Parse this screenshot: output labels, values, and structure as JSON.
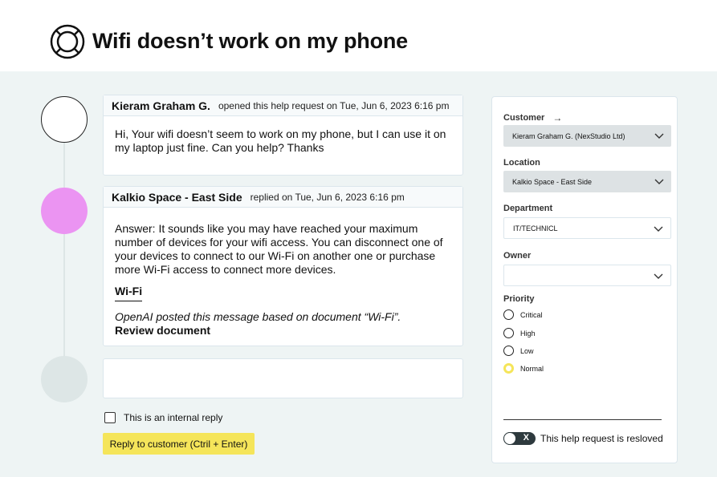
{
  "header": {
    "title": "Wifi doesn’t work on my phone",
    "icon": "lifebuoy-icon"
  },
  "thread": [
    {
      "author": "Kieram Graham G.",
      "meta": "opened this help request on Tue, Jun 6, 2023 6:16 pm",
      "body": "Hi, Your wifi doesn’t seem to work on my phone, but I can use it on my laptop just fine. Can you help? Thanks",
      "avatar_color": "#ffffff"
    },
    {
      "author": "Kalkio Space - East Side",
      "meta": "replied on Tue, Jun 6, 2023 6:16 pm",
      "body": "Answer: It sounds like you may have reached your maximum number of devices for your wifi access. You can disconnect one of your devices to connect to our Wi-Fi on another one or purchase more Wi-Fi access to connect more devices.",
      "doc_link": "Wi-Fi",
      "posted_note": "OpenAI posted this message based on document “Wi-Fi”.",
      "review_link": "Review document",
      "avatar_color": "#eb94f2"
    }
  ],
  "reply": {
    "internal_label": "This is an internal reply",
    "internal_checked": false,
    "button_label": "Reply to customer (Ctril + Enter)",
    "button_color": "#f5e55a"
  },
  "panel": {
    "customer": {
      "label": "Customer",
      "value": "Kieram Graham G. (NexStudio Ltd)"
    },
    "location": {
      "label": "Location",
      "value": "Kalkio Space - East Side"
    },
    "department": {
      "label": "Department",
      "value": "IT/TECHNICL"
    },
    "owner": {
      "label": "Owner",
      "value": ""
    },
    "priority": {
      "label": "Priority",
      "options": [
        "Critical",
        "High",
        "Low",
        "Normal"
      ],
      "selected": "Normal"
    },
    "resolved": {
      "label": "This help request is resloved",
      "toggle_text": "X",
      "on": false
    }
  }
}
